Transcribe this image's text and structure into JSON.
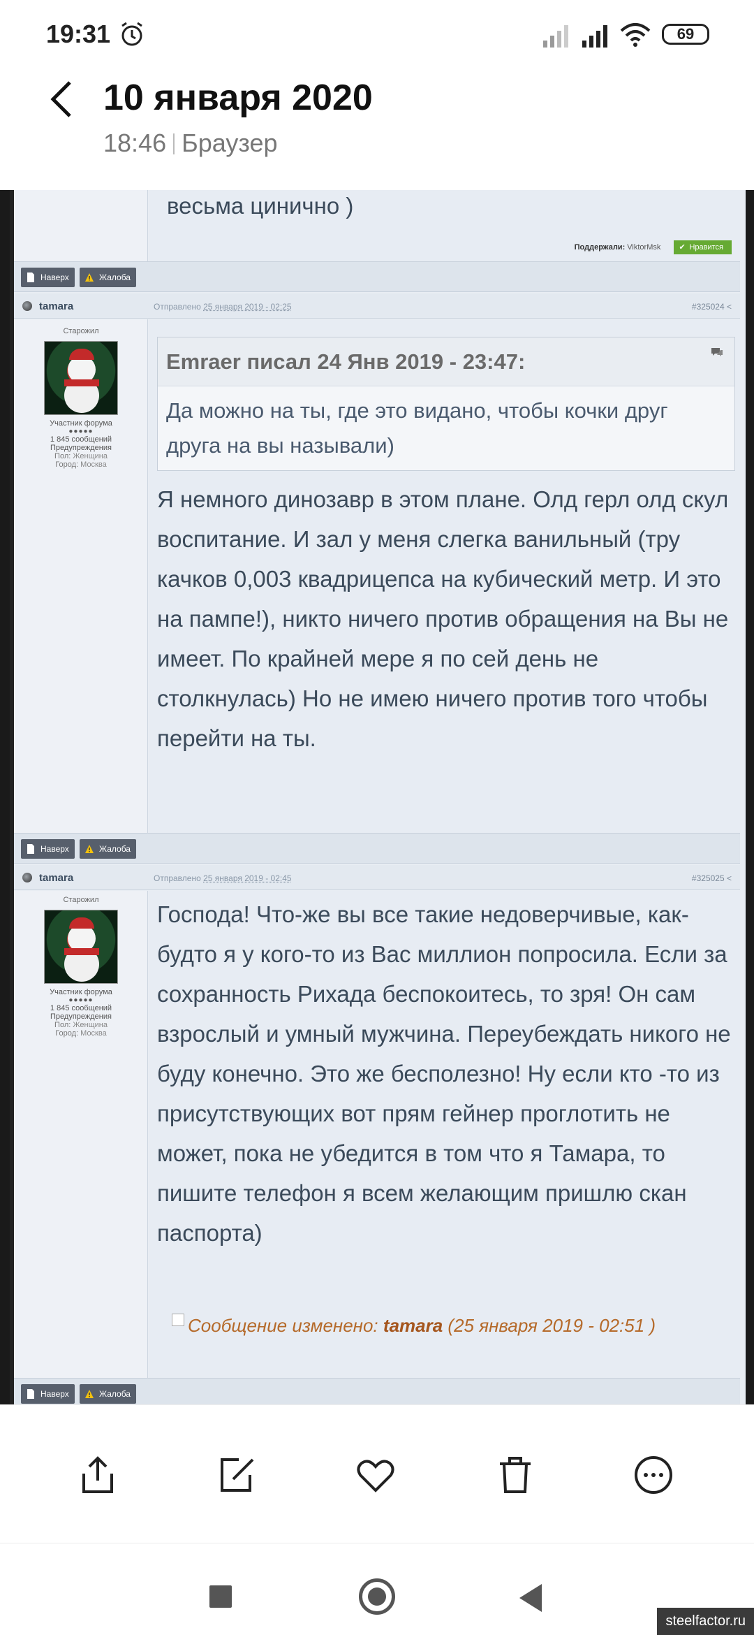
{
  "status_bar": {
    "time": "19:31",
    "battery": "69"
  },
  "header": {
    "title": "10 января 2020",
    "time": "18:46",
    "app": "Браузер"
  },
  "forum": {
    "top_fragment": "весьма цинично )",
    "support_label": "Поддержали:",
    "support_user": "ViktorMsk",
    "like_label": "Нравится",
    "buttons": {
      "top": "Наверх",
      "complaint": "Жалоба"
    },
    "posts": [
      {
        "author": "tamara",
        "posted": "Отправлено",
        "date": "25 января 2019 - 02:25",
        "number": "#325024",
        "rank": "Старожил",
        "group": "Участник форума",
        "dots": "●●●●●",
        "messages": "1 845 сообщений",
        "warnings": "Предупреждения",
        "gender_label": "Пол:",
        "gender": "Женщина",
        "city_label": "Город:",
        "city": "Москва",
        "quote_head": "Emraer писал 24 Янв 2019 - 23:47:",
        "quote_body": "Да можно на ты, где это видано, чтобы кочки друг друга на вы называли)",
        "text": "  Я немного динозавр в этом плане. Олд герл олд скул воспитание. И зал у меня слегка ванильный (тру качков 0,003 квадрицепса на кубический метр. И это на пампе!), никто ничего против обращения на Вы не имеет. По крайней мере я по сей день не столкнулась) Но не имею ничего против того чтобы перейти на ты."
      },
      {
        "author": "tamara",
        "posted": "Отправлено",
        "date": "25 января 2019 - 02:45",
        "number": "#325025",
        "rank": "Старожил",
        "group": "Участник форума",
        "dots": "●●●●●",
        "messages": "1 845 сообщений",
        "warnings": "Предупреждения",
        "gender_label": "Пол:",
        "gender": "Женщина",
        "city_label": "Город:",
        "city": "Москва",
        "text": "    Господа! Что-же вы все такие недоверчивые, как-будто я у кого-то из Вас миллион попросила. Если за сохранность Рихада беспокоитесь, то зря! Он сам взрослый  и умный мужчина. Переубеждать никого не буду конечно. Это же бесполезно! Ну если кто -то из присутствующих вот прям гейнер проглотить не может, пока не убедится в том что я Тамара, то пишите  телефон я всем желающим пришлю скан паспорта)",
        "edit_prefix": "Сообщение изменено:",
        "edit_user": "tamara",
        "edit_date": "(25 января 2019 - 02:51 )"
      }
    ]
  },
  "actions": [
    "share-icon",
    "edit-icon",
    "heart-icon",
    "trash-icon",
    "more-icon"
  ],
  "watermark": "steelfactor.ru"
}
